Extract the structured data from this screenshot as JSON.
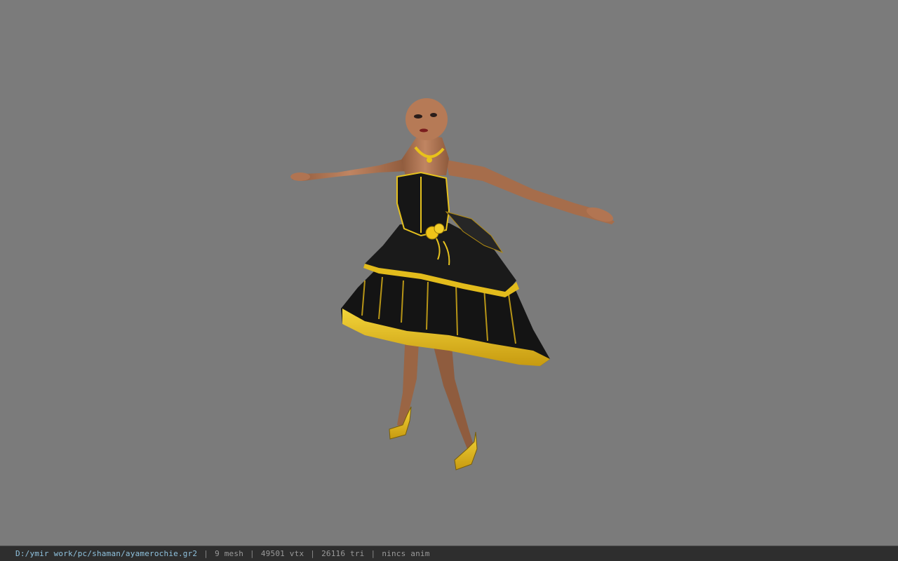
{
  "viewport": {
    "background": "#7b7b7b",
    "model": {
      "description_icon": "3d-character-model",
      "dress_colors": {
        "dark": "#141414",
        "accent": "#e8c21a"
      },
      "skin_color": "#b97a55"
    }
  },
  "statusbar": {
    "file_path": "D:/ymir work/pc/shaman/ayamerochie.gr2",
    "separator": "|",
    "mesh": "9 mesh",
    "vtx": "49501 vtx",
    "tri": "26116 tri",
    "anim": "nincs anim",
    "path_color": "#8fc2de"
  }
}
